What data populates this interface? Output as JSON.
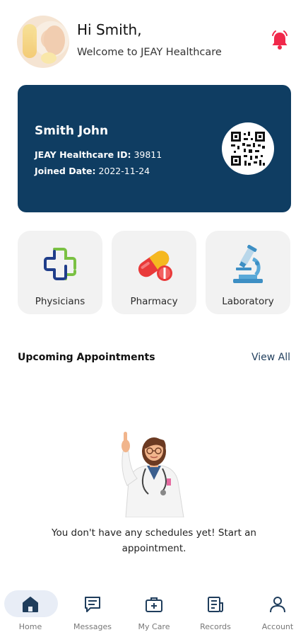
{
  "header": {
    "greeting": "Hi Smith,",
    "welcome": "Welcome to JEAY Healthcare"
  },
  "member_card": {
    "name": "Smith John",
    "id_label": "JEAY Healthcare ID:",
    "id_value": "39811",
    "joined_label": "Joined Date:",
    "joined_value": "2022-11-24"
  },
  "services": [
    {
      "label": "Physicians",
      "icon": "medical-cross-icon"
    },
    {
      "label": "Pharmacy",
      "icon": "pill-icon"
    },
    {
      "label": "Laboratory",
      "icon": "microscope-icon"
    }
  ],
  "appointments": {
    "title": "Upcoming Appointments",
    "view_all": "View All",
    "empty_message": "You don't have any schedules yet! Start an appointment."
  },
  "bottom_nav": [
    {
      "label": "Home",
      "icon": "home-icon",
      "active": true
    },
    {
      "label": "Messages",
      "icon": "message-icon",
      "active": false
    },
    {
      "label": "My Care",
      "icon": "medical-kit-icon",
      "active": false
    },
    {
      "label": "Records",
      "icon": "records-icon",
      "active": false
    },
    {
      "label": "Account",
      "icon": "user-icon",
      "active": false
    }
  ],
  "colors": {
    "card_bg": "#0f3d62",
    "bell": "#f0284a",
    "nav_active_bg": "#e8edf6",
    "nav_active_icon": "#1f3d5c"
  }
}
